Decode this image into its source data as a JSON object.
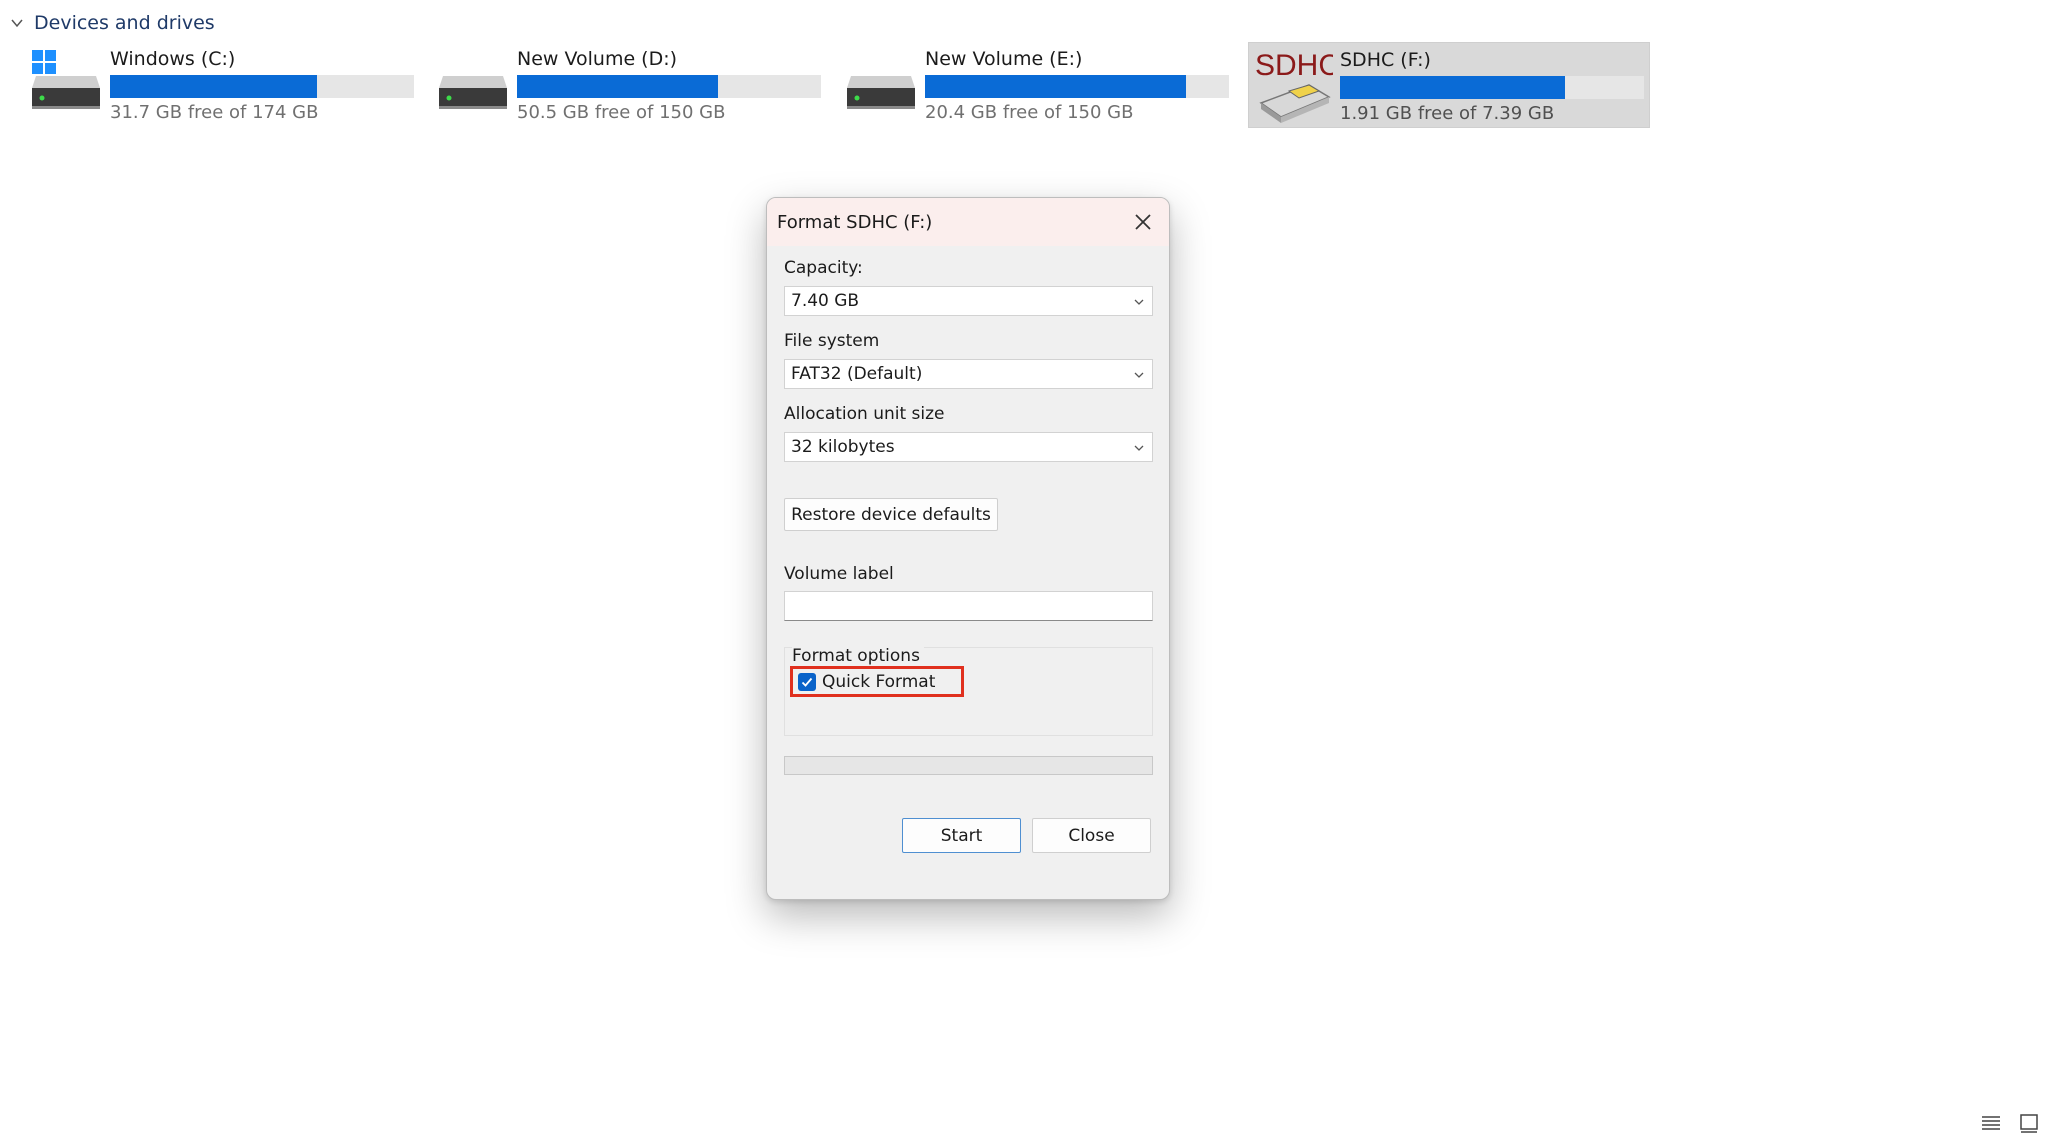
{
  "section": {
    "title": "Devices and drives"
  },
  "drives": [
    {
      "name": "Windows (C:)",
      "free_text": "31.7 GB free of 174 GB",
      "used_fraction": 0.68,
      "icon": "windows-drive-icon"
    },
    {
      "name": "New Volume (D:)",
      "free_text": "50.5 GB free of 150 GB",
      "used_fraction": 0.66,
      "icon": "hard-drive-icon"
    },
    {
      "name": "New Volume (E:)",
      "free_text": "20.4 GB free of 150 GB",
      "used_fraction": 0.86,
      "icon": "hard-drive-icon"
    },
    {
      "name": "SDHC (F:)",
      "free_text": "1.91 GB free of 7.39 GB",
      "used_fraction": 0.74,
      "icon": "sdhc-card-icon",
      "logo_text": "SDHC",
      "selected": true
    }
  ],
  "dialog": {
    "title": "Format SDHC (F:)",
    "capacity_label": "Capacity:",
    "capacity_value": "7.40 GB",
    "filesystem_label": "File system",
    "filesystem_value": "FAT32 (Default)",
    "allocation_label": "Allocation unit size",
    "allocation_value": "32 kilobytes",
    "restore_button": "Restore device defaults",
    "volume_label": "Volume label",
    "volume_value": "",
    "format_options_label": "Format options",
    "quick_format_label": "Quick Format",
    "quick_format_checked": true,
    "progress_fraction": 0,
    "start_button": "Start",
    "close_button": "Close"
  },
  "colors": {
    "accent": "#0a6bd6",
    "highlight": "#e0301e",
    "title_bar": "#fbeeed",
    "sdhc_logo": "#8b1a1a"
  }
}
